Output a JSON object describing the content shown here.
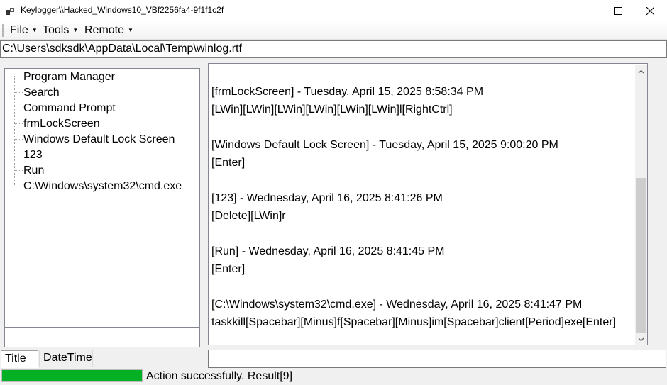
{
  "window": {
    "title": "Keylogger\\\\Hacked_Windows10_VBf2256fa4-9f1f1c2f",
    "app_icon": "keylogger-app-icon",
    "controls": [
      "minimize-icon",
      "maximize-icon",
      "close-icon"
    ]
  },
  "menu": {
    "file": "File",
    "tools": "Tools",
    "remote": "Remote",
    "caret_icon": "caret-down-icon"
  },
  "path": "C:\\Users\\sdksdk\\AppData\\Local\\Temp\\winlog.rtf",
  "tree": {
    "items": [
      "Program Manager",
      "Search",
      "Command Prompt",
      "frmLockScreen",
      "Windows Default Lock Screen",
      "123",
      "Run",
      "C:\\Windows\\system32\\cmd.exe"
    ]
  },
  "tabs": {
    "title": "Title",
    "datetime": "DateTime",
    "active": "Title"
  },
  "log": {
    "lines": [
      "[frmLockScreen] - Tuesday, April 15, 2025 8:58:34 PM",
      "[LWin][LWin][LWin][LWin][LWin][LWin]l[RightCtrl]",
      "",
      "[Windows Default Lock Screen] - Tuesday, April 15, 2025 9:00:20 PM",
      "[Enter]",
      "",
      "[123] - Wednesday, April 16, 2025 8:41:26 PM",
      "[Delete][LWin]r",
      "",
      "[Run] - Wednesday, April 16, 2025 8:41:45 PM",
      "[Enter]",
      "",
      "[C:\\Windows\\system32\\cmd.exe] - Wednesday, April 16, 2025 8:41:47 PM",
      "taskkill[Spacebar][Minus]f[Spacebar][Minus]im[Spacebar]client[Period]exe[Enter]"
    ],
    "scroll_icons": [
      "scroll-up-arrow-icon",
      "scroll-down-arrow-icon"
    ]
  },
  "command_input": {
    "value": ""
  },
  "tree_filter": {
    "value": ""
  },
  "status": {
    "progress_percent": 100,
    "progress_color": "#06b025",
    "text": "Action successfully. Result[9]"
  }
}
